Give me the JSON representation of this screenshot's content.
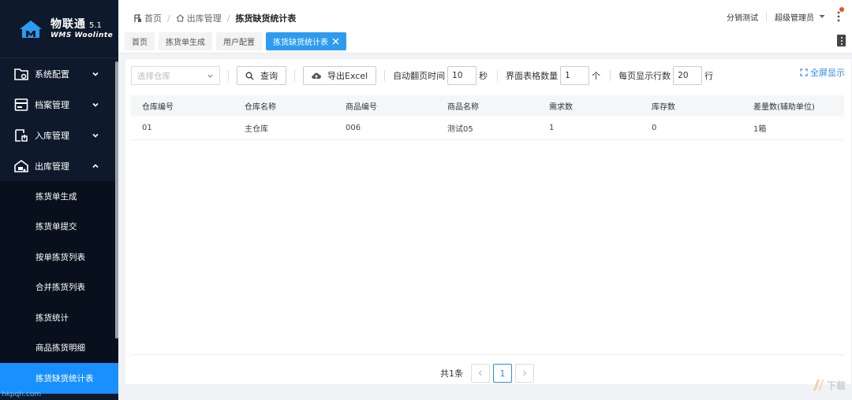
{
  "logo": {
    "name": "物联通",
    "version": "5.1",
    "subtitle": "WMS Woolinte"
  },
  "sidebar": {
    "items": [
      {
        "label": "系统配置",
        "icon": "settings-folder-icon",
        "expanded": false
      },
      {
        "label": "档案管理",
        "icon": "archive-icon",
        "expanded": false
      },
      {
        "label": "入库管理",
        "icon": "inbound-icon",
        "expanded": false
      },
      {
        "label": "出库管理",
        "icon": "outbound-truck-icon",
        "expanded": true
      }
    ],
    "sub_items": [
      {
        "label": "拣货单生成",
        "active": false
      },
      {
        "label": "拣货单提交",
        "active": false
      },
      {
        "label": "按单拣货列表",
        "active": false
      },
      {
        "label": "合并拣货列表",
        "active": false
      },
      {
        "label": "拣货统计",
        "active": false
      },
      {
        "label": "商品拣货明细",
        "active": false
      },
      {
        "label": "拣货缺货统计表",
        "active": true
      }
    ]
  },
  "breadcrumb": {
    "home": "首页",
    "section": "出库管理",
    "current": "拣货缺货统计表"
  },
  "user": {
    "store": "分销测试",
    "role": "超级管理员"
  },
  "tabs": [
    {
      "label": "首页",
      "active": false
    },
    {
      "label": "拣货单生成",
      "active": false
    },
    {
      "label": "用户配置",
      "active": false
    },
    {
      "label": "拣货缺货统计表",
      "active": true
    }
  ],
  "toolbar": {
    "warehouse_placeholder": "选择仓库",
    "query_label": "查询",
    "export_label": "导出Excel",
    "auto_page_label": "自动翻页时间",
    "auto_page_value": "10",
    "auto_page_unit": "秒",
    "table_count_label": "界面表格数量",
    "table_count_value": "1",
    "table_count_unit": "个",
    "rows_per_page_label": "每页显示行数",
    "rows_per_page_value": "20",
    "rows_per_page_unit": "行",
    "fullscreen_label": "全屏显示"
  },
  "table": {
    "columns": [
      "仓库编号",
      "仓库名称",
      "商品编号",
      "商品名称",
      "需求数",
      "库存数",
      "差量数(辅助单位)"
    ],
    "rows": [
      [
        "01",
        "主仓库",
        "006",
        "测试05",
        "1",
        "0",
        "1箱"
      ]
    ]
  },
  "pagination": {
    "total_label": "共1条",
    "current_page": "1"
  },
  "watermarks": {
    "left": "hkpqh.com",
    "right": "下载"
  },
  "colors": {
    "sidebar_bg": "#0e1a2b",
    "accent": "#1890ff",
    "tab_active": "#2d9cf0",
    "link": "#2d8cf0"
  }
}
